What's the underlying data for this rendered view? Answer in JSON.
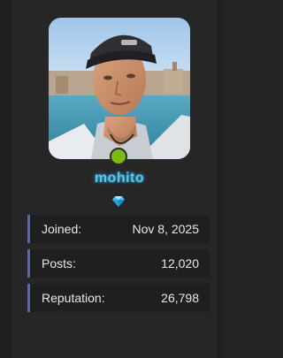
{
  "profile": {
    "username": "mohito",
    "username_color": "#5ac6e6",
    "status_color": "#7cbb12",
    "badge_icon": "diamond-gem-icon"
  },
  "stats": [
    {
      "label": "Joined:",
      "value": "Nov 8, 2025"
    },
    {
      "label": "Posts:",
      "value": "12,020"
    },
    {
      "label": "Reputation:",
      "value": "26,798"
    }
  ],
  "colors": {
    "background": "#262626",
    "row_background": "#1f1f1f",
    "row_accent": "#5a6aa8",
    "text": "#e9e9e9"
  }
}
